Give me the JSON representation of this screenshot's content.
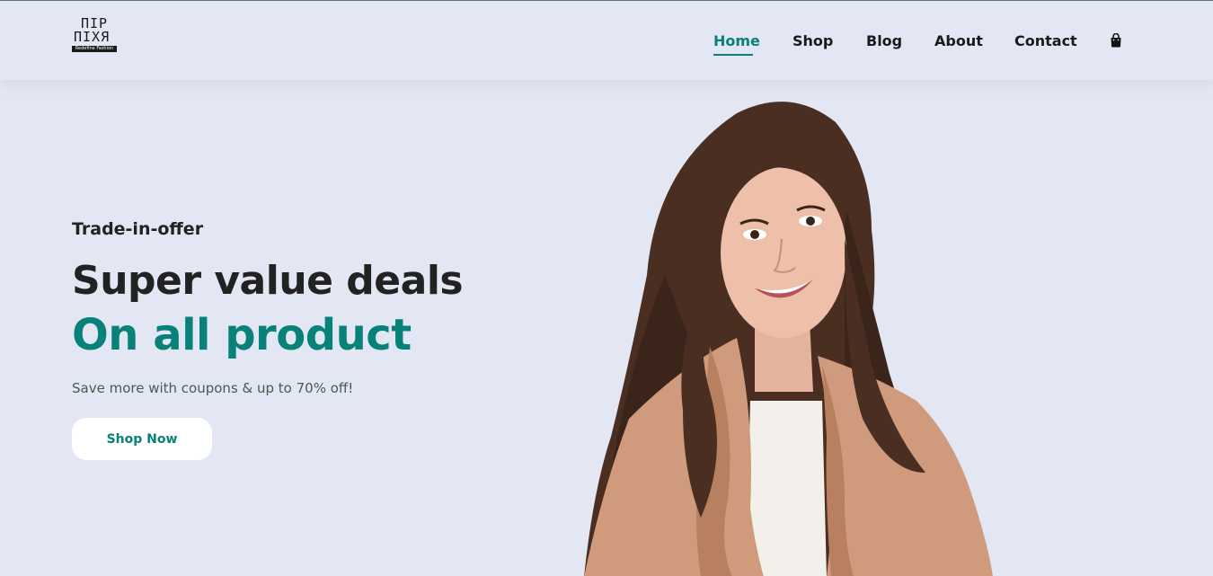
{
  "header": {
    "logo_line1": "ПIP",
    "logo_line2": "ПIXЯ",
    "logo_tagline": "Redefine Fashion",
    "nav": [
      {
        "label": "Home",
        "active": true
      },
      {
        "label": "Shop",
        "active": false
      },
      {
        "label": "Blog",
        "active": false
      },
      {
        "label": "About",
        "active": false
      },
      {
        "label": "Contact",
        "active": false
      }
    ],
    "cart_icon": "shopping-bag-icon"
  },
  "hero": {
    "subtitle": "Trade-in-offer",
    "title": "Super value deals",
    "title_highlight": "On all product",
    "description": "Save more with coupons & up to 70% off!",
    "button_label": "Shop Now",
    "image": "smiling-woman-in-tan-cardigan"
  },
  "colors": {
    "background": "#e3e6f3",
    "accent": "#088178",
    "text_dark": "#222222"
  }
}
